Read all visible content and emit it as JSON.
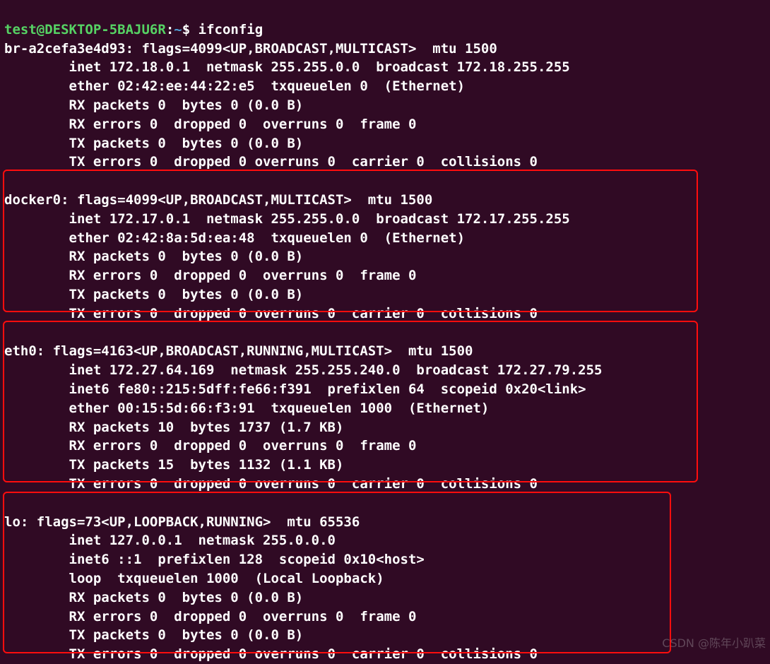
{
  "prompt": {
    "user": "test",
    "host": "DESKTOP-5BAJU6R",
    "path": "~",
    "sep1": "@",
    "sep2": ":",
    "dollar": "$",
    "command": "ifconfig"
  },
  "iface0": {
    "head": "br-a2cefa3e4d93: flags=4099<UP,BROADCAST,MULTICAST>  mtu 1500",
    "l1": "        inet 172.18.0.1  netmask 255.255.0.0  broadcast 172.18.255.255",
    "l2": "        ether 02:42:ee:44:22:e5  txqueuelen 0  (Ethernet)",
    "l3": "        RX packets 0  bytes 0 (0.0 B)",
    "l4": "        RX errors 0  dropped 0  overruns 0  frame 0",
    "l5": "        TX packets 0  bytes 0 (0.0 B)",
    "l6": "        TX errors 0  dropped 0 overruns 0  carrier 0  collisions 0"
  },
  "iface1": {
    "head": "docker0: flags=4099<UP,BROADCAST,MULTICAST>  mtu 1500",
    "l1": "        inet 172.17.0.1  netmask 255.255.0.0  broadcast 172.17.255.255",
    "l2": "        ether 02:42:8a:5d:ea:48  txqueuelen 0  (Ethernet)",
    "l3": "        RX packets 0  bytes 0 (0.0 B)",
    "l4": "        RX errors 0  dropped 0  overruns 0  frame 0",
    "l5": "        TX packets 0  bytes 0 (0.0 B)",
    "l6": "        TX errors 0  dropped 0 overruns 0  carrier 0  collisions 0"
  },
  "iface2": {
    "head": "eth0: flags=4163<UP,BROADCAST,RUNNING,MULTICAST>  mtu 1500",
    "l1": "        inet 172.27.64.169  netmask 255.255.240.0  broadcast 172.27.79.255",
    "l2": "        inet6 fe80::215:5dff:fe66:f391  prefixlen 64  scopeid 0x20<link>",
    "l3": "        ether 00:15:5d:66:f3:91  txqueuelen 1000  (Ethernet)",
    "l4": "        RX packets 10  bytes 1737 (1.7 KB)",
    "l5": "        RX errors 0  dropped 0  overruns 0  frame 0",
    "l6": "        TX packets 15  bytes 1132 (1.1 KB)",
    "l7": "        TX errors 0  dropped 0 overruns 0  carrier 0  collisions 0"
  },
  "iface3": {
    "head": "lo: flags=73<UP,LOOPBACK,RUNNING>  mtu 65536",
    "l1": "        inet 127.0.0.1  netmask 255.0.0.0",
    "l2": "        inet6 ::1  prefixlen 128  scopeid 0x10<host>",
    "l3": "        loop  txqueuelen 1000  (Local Loopback)",
    "l4": "        RX packets 0  bytes 0 (0.0 B)",
    "l5": "        RX errors 0  dropped 0  overruns 0  frame 0",
    "l6": "        TX packets 0  bytes 0 (0.0 B)",
    "l7": "        TX errors 0  dropped 0 overruns 0  carrier 0  collisions 0"
  },
  "watermark": "CSDN @陈年小趴菜"
}
